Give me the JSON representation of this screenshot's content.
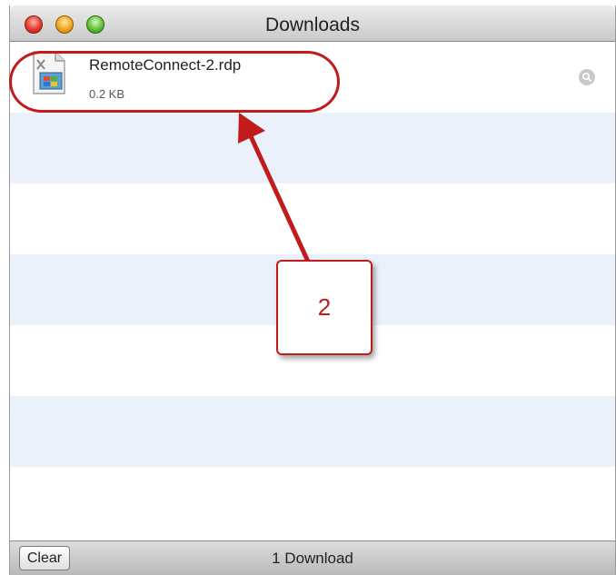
{
  "window": {
    "title": "Downloads"
  },
  "downloads": [
    {
      "file_name": "RemoteConnect-2.rdp",
      "file_size": "0.2 KB",
      "icon": "rdp-file-icon"
    }
  ],
  "bottom_bar": {
    "clear_label": "Clear",
    "status": "1 Download"
  },
  "annotation": {
    "callout_number": "2",
    "color": "#c11b1b"
  },
  "colors": {
    "stripe": "#eaf1fb",
    "accent": "#c11b1b"
  }
}
